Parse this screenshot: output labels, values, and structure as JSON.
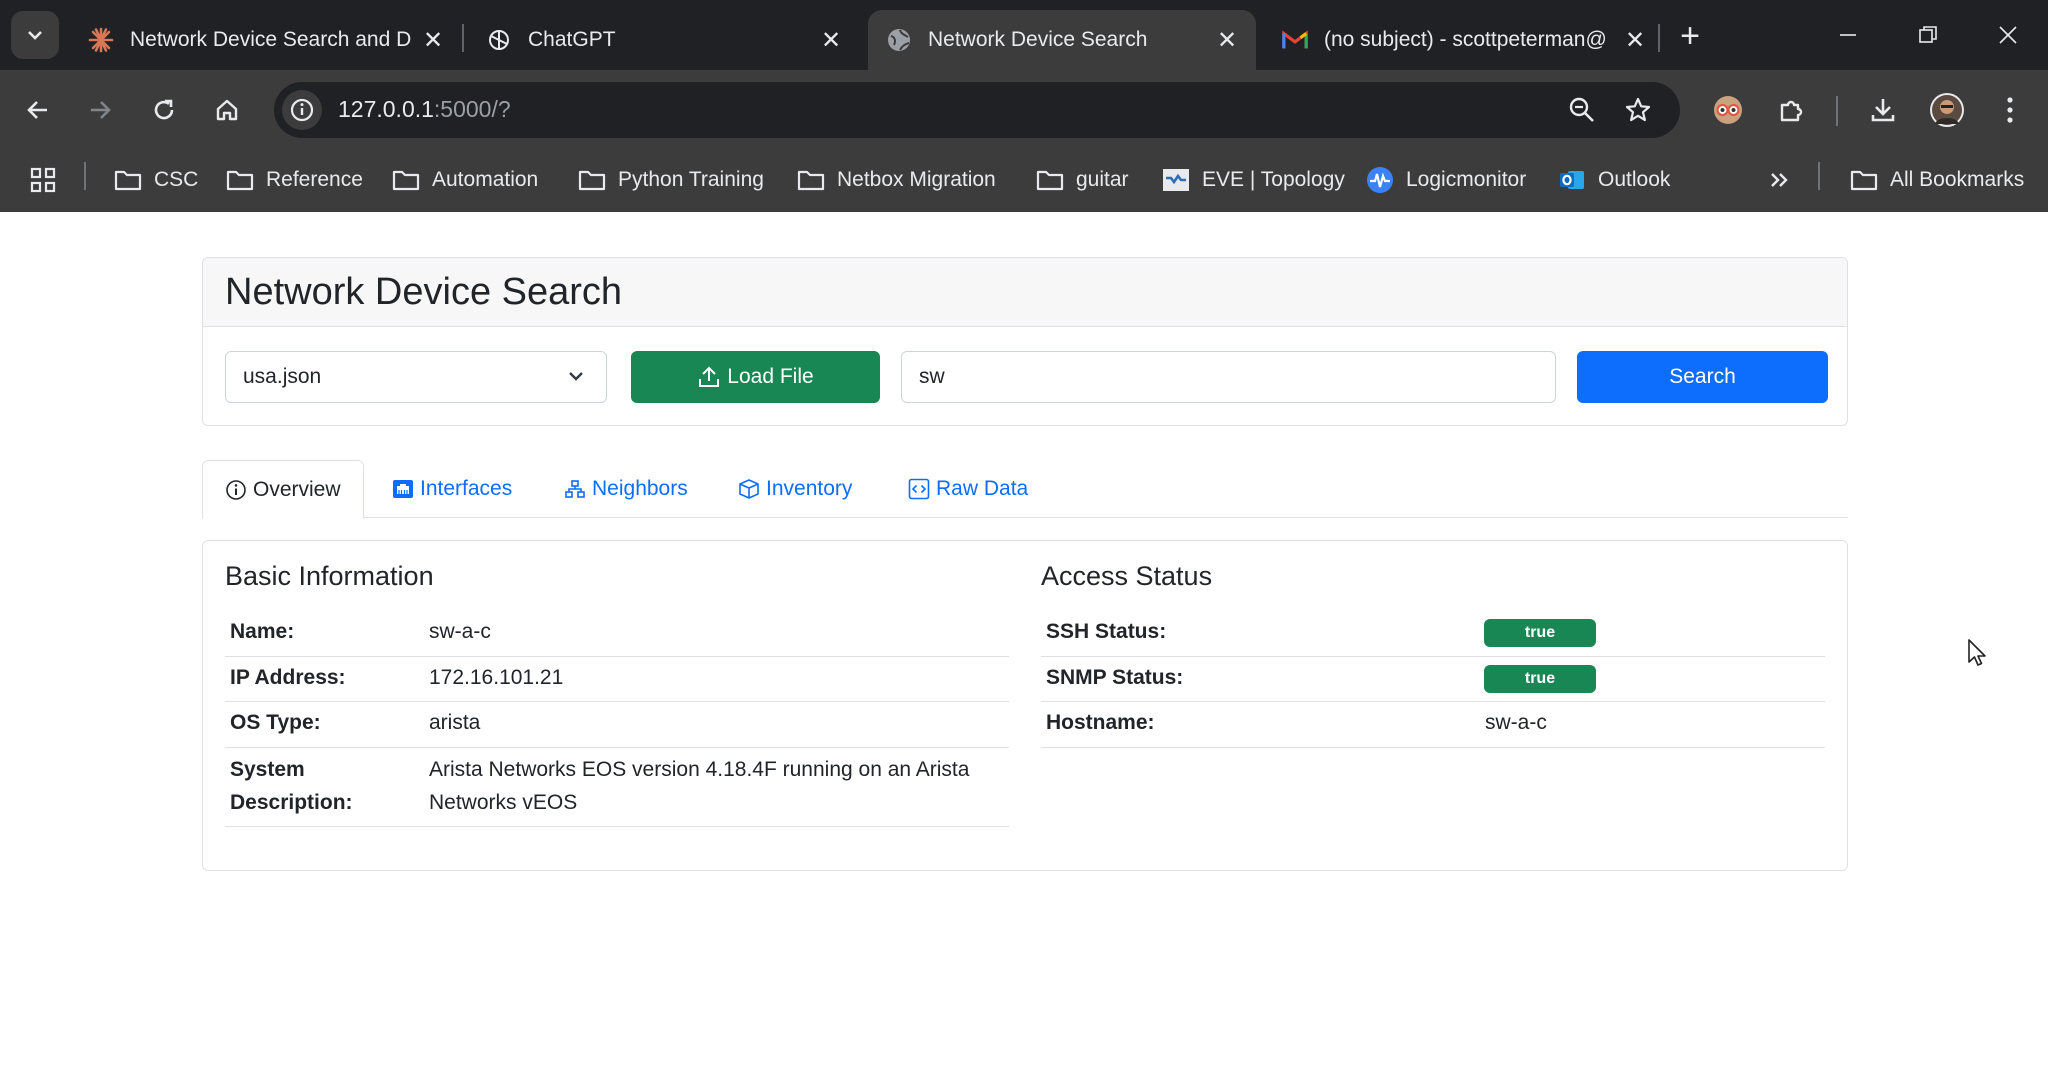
{
  "browser": {
    "tabs": [
      {
        "title": "Network Device Search and D",
        "favicon": "sparkle-icon"
      },
      {
        "title": "ChatGPT",
        "favicon": "openai-icon"
      },
      {
        "title": "Network Device Search",
        "favicon": "globe-icon",
        "active": true
      },
      {
        "title": "(no subject) - scottpeterman@",
        "favicon": "gmail-icon"
      }
    ],
    "url_host": "127.0.0.1",
    "url_rest": ":5000/?",
    "bookmarks": [
      {
        "label": "CSC",
        "icon": "folder-icon"
      },
      {
        "label": "Reference",
        "icon": "folder-icon"
      },
      {
        "label": "Automation",
        "icon": "folder-icon"
      },
      {
        "label": "Python Training",
        "icon": "folder-icon"
      },
      {
        "label": "Netbox Migration",
        "icon": "folder-icon"
      },
      {
        "label": "guitar",
        "icon": "folder-icon"
      },
      {
        "label": "EVE | Topology",
        "icon": "eve-icon"
      },
      {
        "label": "Logicmonitor",
        "icon": "logicmonitor-icon"
      },
      {
        "label": "Outlook",
        "icon": "outlook-icon"
      }
    ],
    "all_bookmarks": "All Bookmarks"
  },
  "page": {
    "title": "Network Device Search",
    "file_select": {
      "value": "usa.json"
    },
    "load_button": "Load File",
    "search_input": {
      "value": "sw"
    },
    "search_button": "Search",
    "tabs": [
      {
        "label": "Overview",
        "icon": "info-icon",
        "active": true
      },
      {
        "label": "Interfaces",
        "icon": "ethernet-icon"
      },
      {
        "label": "Neighbors",
        "icon": "diagram-icon"
      },
      {
        "label": "Inventory",
        "icon": "box-icon"
      },
      {
        "label": "Raw Data",
        "icon": "code-icon"
      }
    ],
    "basic_info": {
      "title": "Basic Information",
      "rows": [
        {
          "label": "Name:",
          "value": "sw-a-c"
        },
        {
          "label": "IP Address:",
          "value": "172.16.101.21"
        },
        {
          "label": "OS Type:",
          "value": "arista"
        },
        {
          "label_line1": "System",
          "label_line2": "Description:",
          "value_line1": "Arista Networks EOS version 4.18.4F running on an Arista",
          "value_line2": "Networks vEOS"
        }
      ]
    },
    "access_status": {
      "title": "Access Status",
      "rows": [
        {
          "label": "SSH Status:",
          "badge": "true"
        },
        {
          "label": "SNMP Status:",
          "badge": "true"
        },
        {
          "label": "Hostname:",
          "value": "sw-a-c"
        }
      ]
    }
  },
  "colors": {
    "primary": "#0d6efd",
    "success": "#198754",
    "chrome_dark": "#202124",
    "chrome_toolbar": "#3c3c3c"
  }
}
